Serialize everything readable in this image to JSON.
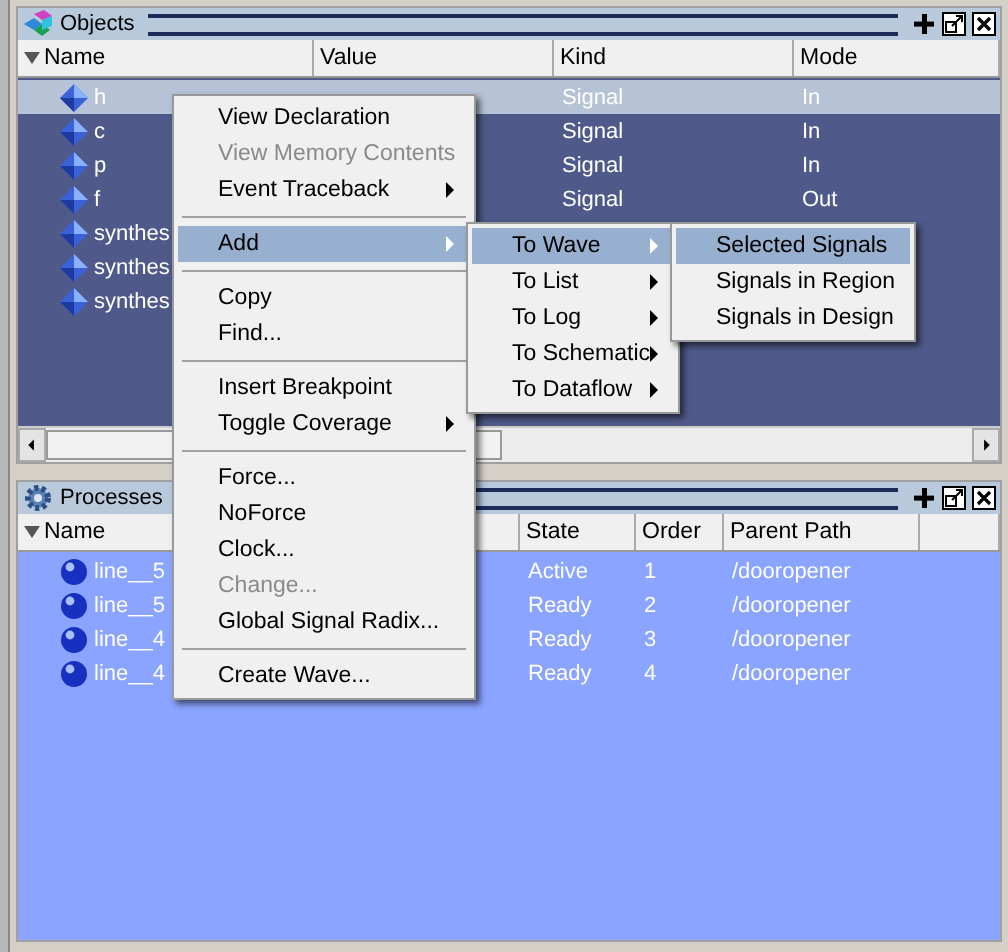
{
  "objects_panel": {
    "title": "Objects",
    "columns": [
      {
        "label": "Name"
      },
      {
        "label": "Value"
      },
      {
        "label": "Kind"
      },
      {
        "label": "Mode"
      }
    ],
    "rows": [
      {
        "name": "h",
        "kind": "Signal",
        "mode": "In",
        "selected": true
      },
      {
        "name": "c",
        "kind": "Signal",
        "mode": "In",
        "selected": false
      },
      {
        "name": "p",
        "kind": "Signal",
        "mode": "In",
        "selected": false
      },
      {
        "name": "f",
        "kind": "Signal",
        "mode": "Out",
        "selected": false
      },
      {
        "name": "synthes",
        "selected": false
      },
      {
        "name": "synthes",
        "selected": false
      },
      {
        "name": "synthes",
        "selected": false
      }
    ]
  },
  "processes_panel": {
    "title": "Processes",
    "columns": [
      {
        "label": "Name"
      },
      {
        "label": "State"
      },
      {
        "label": "Order"
      },
      {
        "label": "Parent Path"
      }
    ],
    "rows": [
      {
        "name": "line__5",
        "state": "Active",
        "order": "1",
        "parent_path": "/dooropener"
      },
      {
        "name": "line__5",
        "state": "Ready",
        "order": "2",
        "parent_path": "/dooropener"
      },
      {
        "name": "line__4",
        "state": "Ready",
        "order": "3",
        "parent_path": "/dooropener"
      },
      {
        "name": "line__4",
        "state": "Ready",
        "order": "4",
        "parent_path": "/dooropener"
      }
    ]
  },
  "context_menu": {
    "items": [
      {
        "kind": "item",
        "label": "View Declaration",
        "disabled": false,
        "submenu": false,
        "selected": false
      },
      {
        "kind": "item",
        "label": "View Memory Contents",
        "disabled": true,
        "submenu": false,
        "selected": false
      },
      {
        "kind": "item",
        "label": "Event Traceback",
        "disabled": false,
        "submenu": true,
        "selected": false
      },
      {
        "kind": "separator"
      },
      {
        "kind": "item",
        "label": "Add",
        "disabled": false,
        "submenu": true,
        "selected": true
      },
      {
        "kind": "separator"
      },
      {
        "kind": "item",
        "label": "Copy",
        "disabled": false,
        "submenu": false,
        "selected": false
      },
      {
        "kind": "item",
        "label": "Find...",
        "disabled": false,
        "submenu": false,
        "selected": false
      },
      {
        "kind": "separator"
      },
      {
        "kind": "item",
        "label": "Insert Breakpoint",
        "disabled": false,
        "submenu": false,
        "selected": false
      },
      {
        "kind": "item",
        "label": "Toggle Coverage",
        "disabled": false,
        "submenu": true,
        "selected": false
      },
      {
        "kind": "separator"
      },
      {
        "kind": "item",
        "label": "Force...",
        "disabled": false,
        "submenu": false,
        "selected": false
      },
      {
        "kind": "item",
        "label": "NoForce",
        "disabled": false,
        "submenu": false,
        "selected": false
      },
      {
        "kind": "item",
        "label": "Clock...",
        "disabled": false,
        "submenu": false,
        "selected": false
      },
      {
        "kind": "item",
        "label": "Change...",
        "disabled": true,
        "submenu": false,
        "selected": false
      },
      {
        "kind": "item",
        "label": "Global Signal Radix...",
        "disabled": false,
        "submenu": false,
        "selected": false
      },
      {
        "kind": "separator"
      },
      {
        "kind": "item",
        "label": "Create Wave...",
        "disabled": false,
        "submenu": false,
        "selected": false
      }
    ]
  },
  "add_submenu": {
    "items": [
      {
        "label": "To Wave",
        "submenu": true,
        "selected": true
      },
      {
        "label": "To List",
        "submenu": true,
        "selected": false
      },
      {
        "label": "To Log",
        "submenu": true,
        "selected": false
      },
      {
        "label": "To Schematic",
        "submenu": true,
        "selected": false
      },
      {
        "label": "To Dataflow",
        "submenu": true,
        "selected": false
      }
    ]
  },
  "wave_submenu": {
    "items": [
      {
        "label": "Selected Signals",
        "selected": true
      },
      {
        "label": "Signals in Region",
        "selected": false
      },
      {
        "label": "Signals in Design",
        "selected": false
      }
    ]
  }
}
